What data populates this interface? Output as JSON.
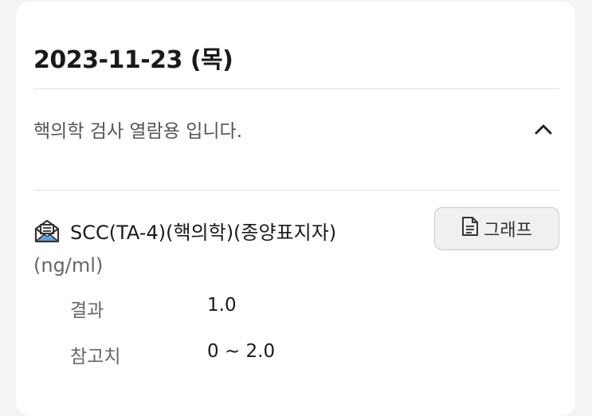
{
  "header": {
    "date": "2023-11-23 (목)"
  },
  "notice": {
    "text": "핵의학 검사 열람용 입니다.",
    "toggle_icon": "chevron-up-icon"
  },
  "test": {
    "icon": "mail-open-icon",
    "name": "SCC(TA-4)(핵의학)(종양표지자)",
    "unit": "(ng/ml)",
    "graph_button_label": "그래프",
    "graph_button_icon": "document-icon",
    "rows": [
      {
        "label": "결과",
        "value": "1.0"
      },
      {
        "label": "참고치",
        "value": "0 ~ 2.0"
      }
    ]
  },
  "colors": {
    "card_background": "#ffffff",
    "page_background": "#f4f4f4",
    "button_background": "#f0f0f0"
  }
}
